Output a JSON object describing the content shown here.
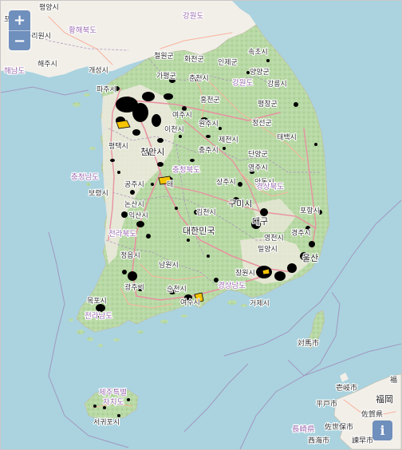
{
  "map": {
    "labels": {
      "pyongyang": "평양시",
      "gangwon_north": "강원도",
      "hwanghae_north": "황해북도",
      "sariwon": "사리원시",
      "haeju": "해주시",
      "hwanghae_south": "해남도",
      "kaesong": "개성시",
      "cheorwon": "철원군",
      "hwacheon": "화천군",
      "inje": "인제군",
      "sokcho": "속초시",
      "yangyang": "양양군",
      "chuncheon": "춘천시",
      "gangwon": "강원도",
      "gangneung": "강릉시",
      "paju": "파주시",
      "gapyeong": "가평군",
      "hongcheon": "홍천군",
      "pyeongchang": "평창군",
      "jeongseon": "정선군",
      "wonju": "원주시",
      "yeoju": "여주시",
      "icheon": "이천시",
      "jecheon": "제천시",
      "taebaek": "태백시",
      "chungju": "충주시",
      "danyang": "단양군",
      "pyeongtaek": "평택시",
      "yeongju": "영주시",
      "cheonan": "천안시",
      "chungbuk": "충청북도",
      "andong": "안동시",
      "chungnam": "충청남도",
      "boryeong": "보령시",
      "gongju": "공주시",
      "daejeon_frag": "대",
      "sangju": "상주시",
      "gyeongbuk": "경상북도",
      "nonsan": "논산시",
      "gimcheon": "김천시",
      "gumi": "구미시",
      "pohang": "포항시",
      "daegu": "대구",
      "iksan": "익산시",
      "jeonbuk": "전라북도",
      "korea": "대한민국",
      "yeongcheon": "영천시",
      "gyeongju": "경주시",
      "miryang": "밀양시",
      "jeongeup": "정읍시",
      "ulsan": "울산",
      "namwon": "남원시",
      "gwangju": "광주시",
      "changwon": "창원시",
      "suncheon": "순천시",
      "gyeongnam": "경상남도",
      "mokpo": "목포시",
      "yeosu": "여수시",
      "geoje": "거제시",
      "jeonnam": "전라남도",
      "tsushima": "対馬市",
      "jeju_province": "제주특별",
      "jeju_city": "자치도",
      "seogwipo": "서귀포시",
      "iki": "壱岐市",
      "hirado": "平戸市",
      "fukuoka": "福岡",
      "saga": "佐賀県",
      "sasebo": "佐世保市",
      "nagasaki": "長崎県",
      "saikai": "西海市",
      "isahaya": "諫早市",
      "fukuoka_frag": "福",
      "po_frag": "포",
      "haenam_frag": "해남도"
    },
    "controls": {
      "zoom_in": "+",
      "zoom_out": "−",
      "info": "i"
    },
    "colors": {
      "sea": "#aad3df",
      "land": "#f2efe9",
      "forest": "#b7d8a4",
      "boundary": "#9e7fb0",
      "road_major": "#e892a2",
      "road_secondary": "#f9b29c",
      "marker": "#000000",
      "highlight": "#f5c400",
      "control": "#6f8fbd"
    }
  }
}
